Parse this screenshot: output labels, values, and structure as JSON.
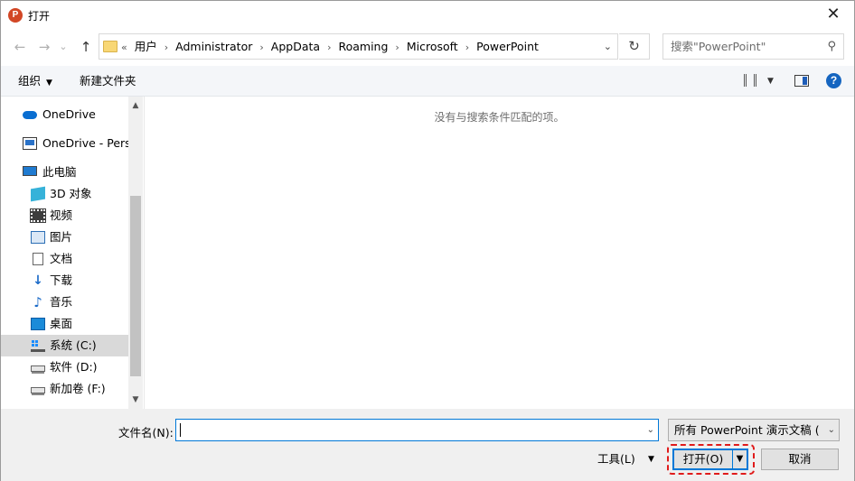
{
  "window": {
    "title": "打开",
    "app_icon_letter": "P",
    "close_glyph": "✕"
  },
  "nav": {
    "back_glyph": "←",
    "forward_glyph": "→",
    "history_glyph": "⌄",
    "up_glyph": "↑"
  },
  "address": {
    "overflow": "«",
    "crumbs": [
      "用户",
      "Administrator",
      "AppData",
      "Roaming",
      "Microsoft",
      "PowerPoint"
    ],
    "separator": "›",
    "dropdown_glyph": "⌄",
    "refresh_glyph": "↻"
  },
  "search": {
    "placeholder": "搜索\"PowerPoint\"",
    "icon_glyph": "⚲"
  },
  "toolbar": {
    "organize_label": "组织",
    "organize_caret": "▼",
    "new_folder_label": "新建文件夹",
    "view_caret": "▼",
    "help_glyph": "?"
  },
  "sidebar": {
    "items": [
      {
        "label": "OneDrive",
        "icon": "cloud-icon"
      },
      {
        "label": "OneDrive - Personal",
        "icon": "monitor-icon"
      },
      {
        "label": "此电脑",
        "icon": "pc-icon"
      },
      {
        "label": "3D 对象",
        "icon": "cube-3d-icon"
      },
      {
        "label": "视频",
        "icon": "video-icon"
      },
      {
        "label": "图片",
        "icon": "picture-icon"
      },
      {
        "label": "文档",
        "icon": "document-icon"
      },
      {
        "label": "下载",
        "icon": "download-icon"
      },
      {
        "label": "音乐",
        "icon": "music-icon"
      },
      {
        "label": "桌面",
        "icon": "desktop-icon"
      },
      {
        "label": "系统 (C:)",
        "icon": "system-drive-icon",
        "selected": true
      },
      {
        "label": "软件 (D:)",
        "icon": "drive-icon"
      },
      {
        "label": "新加卷 (F:)",
        "icon": "drive-icon"
      }
    ],
    "scroll_up_glyph": "▲",
    "scroll_down_glyph": "▼"
  },
  "content": {
    "empty_message": "没有与搜索条件匹配的项。"
  },
  "footer": {
    "filename_label": "文件名(N):",
    "filename_value": "",
    "filename_drop_glyph": "⌄",
    "filetype_value": "所有 PowerPoint 演示文稿 (*.pptx;*.ppt)",
    "filetype_drop_glyph": "⌄",
    "tools_label": "工具(L)",
    "tools_caret": "▼",
    "open_label": "打开(O)",
    "open_drop_glyph": "▼",
    "cancel_label": "取消"
  },
  "colors": {
    "accent": "#0078d7",
    "highlight": "#e01b1b",
    "toolbar_bg": "#f4f6f9",
    "footer_bg": "#f0f0f0"
  }
}
